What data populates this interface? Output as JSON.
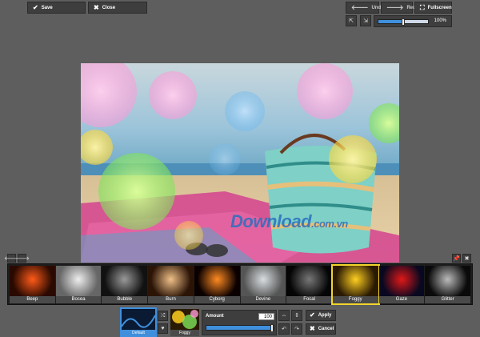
{
  "toolbar": {
    "save_label": "Save",
    "close_label": "Close",
    "undo_label": "Undo",
    "redo_label": "Redo",
    "fullscreen_label": "Fullscreen"
  },
  "zoom": {
    "value_text": "100%",
    "level": 0.5
  },
  "filters": [
    {
      "label": "Beep",
      "colors": [
        "#2a0a00",
        "#ff5a1a"
      ]
    },
    {
      "label": "Bocea",
      "colors": [
        "#666",
        "#eee"
      ]
    },
    {
      "label": "Bubble",
      "colors": [
        "#111",
        "#999"
      ]
    },
    {
      "label": "Burn",
      "colors": [
        "#2b1406",
        "#f0c088"
      ]
    },
    {
      "label": "Cyborg",
      "colors": [
        "#0a0000",
        "#ff8a22"
      ]
    },
    {
      "label": "Devine",
      "colors": [
        "#555",
        "#d8dde0"
      ]
    },
    {
      "label": "Focal",
      "colors": [
        "#050505",
        "#777"
      ]
    },
    {
      "label": "Foggy",
      "colors": [
        "#2a1a04",
        "#ffcf20"
      ]
    },
    {
      "label": "Gaze",
      "colors": [
        "#080820",
        "#e01818"
      ]
    },
    {
      "label": "Glitter",
      "colors": [
        "#0a0a0a",
        "#bbb"
      ]
    }
  ],
  "selected_filter": "Foggy",
  "panel": {
    "default_label": "Default",
    "selected_label": "Foggy",
    "amount_label": "Amount",
    "amount_value": "100",
    "amount_level": 1.0,
    "apply_label": "Apply",
    "cancel_label": "Cancel"
  },
  "watermark": {
    "main": "Download",
    "suffix": ".com.vn"
  },
  "colors": {
    "background": "#5e5e5e",
    "button": "#3e3e3e",
    "accent": "#3f8fdc",
    "selected_outline": "#f3d52a"
  },
  "icons": {
    "save": "check-icon",
    "close": "x-icon",
    "undo": "arrow-left-icon",
    "redo": "arrow-right-icon",
    "fullscreen": "expand-icon"
  }
}
